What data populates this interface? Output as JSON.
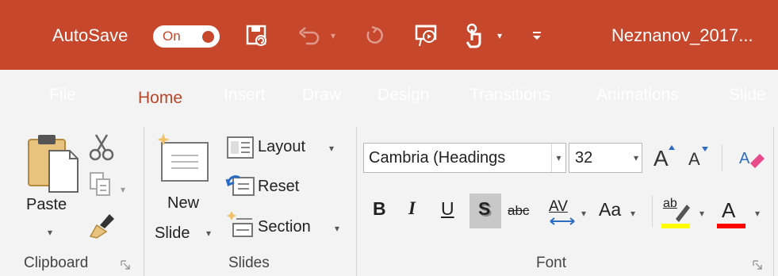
{
  "titlebar": {
    "autosave_label": "AutoSave",
    "autosave_state": "On",
    "document_title": "Neznanov_2017...",
    "bg_color": "#c6472b",
    "qat_icons": [
      "save-icon",
      "undo-icon",
      "redo-icon",
      "present-from-beginning-icon",
      "touch-mode-icon",
      "customize-qat-icon"
    ]
  },
  "tabs": [
    "File",
    "Home",
    "Insert",
    "Draw",
    "Design",
    "Transitions",
    "Animations",
    "Slide"
  ],
  "active_tab": "Home",
  "ribbon": {
    "clipboard": {
      "label": "Clipboard",
      "paste": "Paste",
      "icons": [
        "paste-icon",
        "cut-icon",
        "copy-icon",
        "format-painter-icon"
      ]
    },
    "slides": {
      "label": "Slides",
      "new_slide_line1": "New",
      "new_slide_line2": "Slide",
      "layout": "Layout",
      "reset": "Reset",
      "section": "Section"
    },
    "font": {
      "label": "Font",
      "font_name": "Cambria (Headings",
      "font_size": "32",
      "increase_size": "A",
      "decrease_size": "A",
      "bold": "B",
      "italic": "I",
      "underline": "U",
      "shadow": "S",
      "strikethrough": "abc",
      "char_spacing": "AV",
      "change_case": "Aa",
      "highlight": "ab",
      "font_color": "A",
      "highlight_color": "#ffff00",
      "font_color_value": "#ff0000"
    }
  }
}
